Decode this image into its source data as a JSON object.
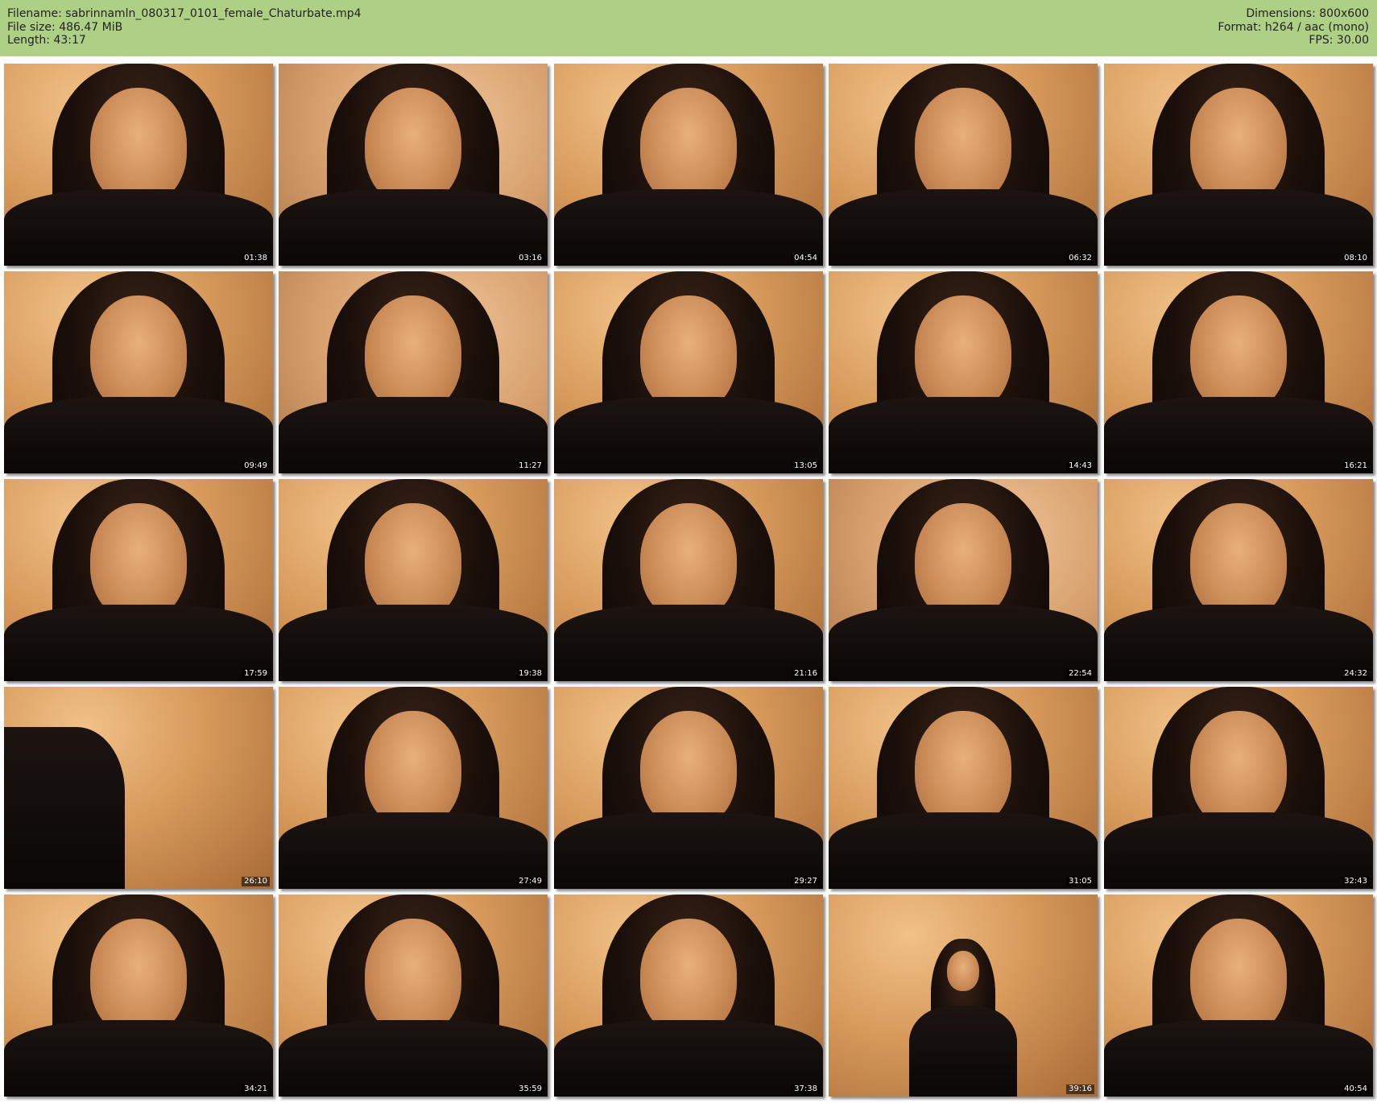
{
  "header": {
    "filename": "Filename: sabrinnamln_080317_0101_female_Chaturbate.mp4",
    "filesize": "File size: 486.47 MiB",
    "length": "Length: 43:17",
    "dimensions": "Dimensions: 800x600",
    "format": "Format: h264 / aac (mono)",
    "fps": "FPS: 30.00",
    "background_color": "#aed084"
  },
  "thumbnails": [
    {
      "time": "01:38"
    },
    {
      "time": "03:16"
    },
    {
      "time": "04:54"
    },
    {
      "time": "06:32"
    },
    {
      "time": "08:10"
    },
    {
      "time": "09:49"
    },
    {
      "time": "11:27"
    },
    {
      "time": "13:05"
    },
    {
      "time": "14:43"
    },
    {
      "time": "16:21"
    },
    {
      "time": "17:59"
    },
    {
      "time": "19:38"
    },
    {
      "time": "21:16"
    },
    {
      "time": "22:54"
    },
    {
      "time": "24:32"
    },
    {
      "time": "26:10"
    },
    {
      "time": "27:49"
    },
    {
      "time": "29:27"
    },
    {
      "time": "31:05"
    },
    {
      "time": "32:43"
    },
    {
      "time": "34:21"
    },
    {
      "time": "35:59"
    },
    {
      "time": "37:38"
    },
    {
      "time": "39:16"
    },
    {
      "time": "40:54"
    }
  ]
}
